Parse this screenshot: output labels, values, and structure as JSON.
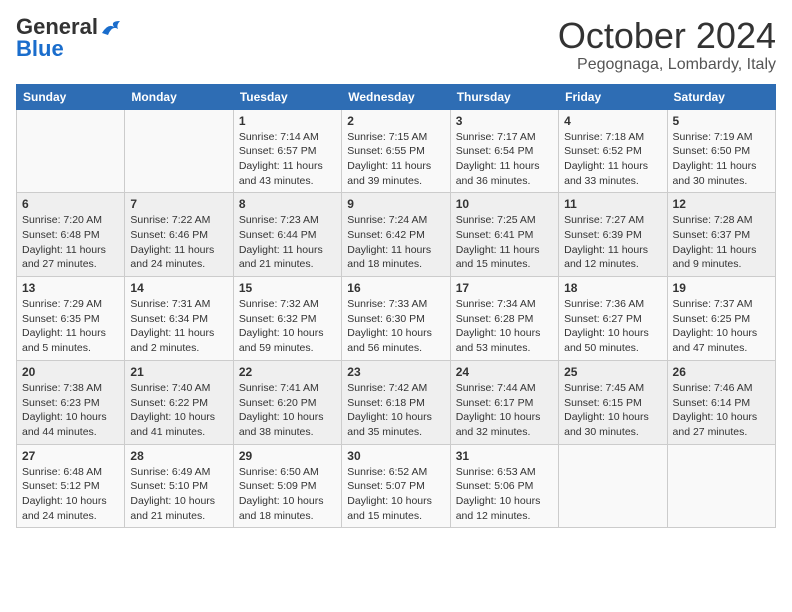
{
  "header": {
    "logo_general": "General",
    "logo_blue": "Blue",
    "title": "October 2024",
    "subtitle": "Pegognaga, Lombardy, Italy"
  },
  "calendar": {
    "days_of_week": [
      "Sunday",
      "Monday",
      "Tuesday",
      "Wednesday",
      "Thursday",
      "Friday",
      "Saturday"
    ],
    "weeks": [
      [
        {
          "day": "",
          "content": ""
        },
        {
          "day": "",
          "content": ""
        },
        {
          "day": "1",
          "content": "Sunrise: 7:14 AM\nSunset: 6:57 PM\nDaylight: 11 hours and 43 minutes."
        },
        {
          "day": "2",
          "content": "Sunrise: 7:15 AM\nSunset: 6:55 PM\nDaylight: 11 hours and 39 minutes."
        },
        {
          "day": "3",
          "content": "Sunrise: 7:17 AM\nSunset: 6:54 PM\nDaylight: 11 hours and 36 minutes."
        },
        {
          "day": "4",
          "content": "Sunrise: 7:18 AM\nSunset: 6:52 PM\nDaylight: 11 hours and 33 minutes."
        },
        {
          "day": "5",
          "content": "Sunrise: 7:19 AM\nSunset: 6:50 PM\nDaylight: 11 hours and 30 minutes."
        }
      ],
      [
        {
          "day": "6",
          "content": "Sunrise: 7:20 AM\nSunset: 6:48 PM\nDaylight: 11 hours and 27 minutes."
        },
        {
          "day": "7",
          "content": "Sunrise: 7:22 AM\nSunset: 6:46 PM\nDaylight: 11 hours and 24 minutes."
        },
        {
          "day": "8",
          "content": "Sunrise: 7:23 AM\nSunset: 6:44 PM\nDaylight: 11 hours and 21 minutes."
        },
        {
          "day": "9",
          "content": "Sunrise: 7:24 AM\nSunset: 6:42 PM\nDaylight: 11 hours and 18 minutes."
        },
        {
          "day": "10",
          "content": "Sunrise: 7:25 AM\nSunset: 6:41 PM\nDaylight: 11 hours and 15 minutes."
        },
        {
          "day": "11",
          "content": "Sunrise: 7:27 AM\nSunset: 6:39 PM\nDaylight: 11 hours and 12 minutes."
        },
        {
          "day": "12",
          "content": "Sunrise: 7:28 AM\nSunset: 6:37 PM\nDaylight: 11 hours and 9 minutes."
        }
      ],
      [
        {
          "day": "13",
          "content": "Sunrise: 7:29 AM\nSunset: 6:35 PM\nDaylight: 11 hours and 5 minutes."
        },
        {
          "day": "14",
          "content": "Sunrise: 7:31 AM\nSunset: 6:34 PM\nDaylight: 11 hours and 2 minutes."
        },
        {
          "day": "15",
          "content": "Sunrise: 7:32 AM\nSunset: 6:32 PM\nDaylight: 10 hours and 59 minutes."
        },
        {
          "day": "16",
          "content": "Sunrise: 7:33 AM\nSunset: 6:30 PM\nDaylight: 10 hours and 56 minutes."
        },
        {
          "day": "17",
          "content": "Sunrise: 7:34 AM\nSunset: 6:28 PM\nDaylight: 10 hours and 53 minutes."
        },
        {
          "day": "18",
          "content": "Sunrise: 7:36 AM\nSunset: 6:27 PM\nDaylight: 10 hours and 50 minutes."
        },
        {
          "day": "19",
          "content": "Sunrise: 7:37 AM\nSunset: 6:25 PM\nDaylight: 10 hours and 47 minutes."
        }
      ],
      [
        {
          "day": "20",
          "content": "Sunrise: 7:38 AM\nSunset: 6:23 PM\nDaylight: 10 hours and 44 minutes."
        },
        {
          "day": "21",
          "content": "Sunrise: 7:40 AM\nSunset: 6:22 PM\nDaylight: 10 hours and 41 minutes."
        },
        {
          "day": "22",
          "content": "Sunrise: 7:41 AM\nSunset: 6:20 PM\nDaylight: 10 hours and 38 minutes."
        },
        {
          "day": "23",
          "content": "Sunrise: 7:42 AM\nSunset: 6:18 PM\nDaylight: 10 hours and 35 minutes."
        },
        {
          "day": "24",
          "content": "Sunrise: 7:44 AM\nSunset: 6:17 PM\nDaylight: 10 hours and 32 minutes."
        },
        {
          "day": "25",
          "content": "Sunrise: 7:45 AM\nSunset: 6:15 PM\nDaylight: 10 hours and 30 minutes."
        },
        {
          "day": "26",
          "content": "Sunrise: 7:46 AM\nSunset: 6:14 PM\nDaylight: 10 hours and 27 minutes."
        }
      ],
      [
        {
          "day": "27",
          "content": "Sunrise: 6:48 AM\nSunset: 5:12 PM\nDaylight: 10 hours and 24 minutes."
        },
        {
          "day": "28",
          "content": "Sunrise: 6:49 AM\nSunset: 5:10 PM\nDaylight: 10 hours and 21 minutes."
        },
        {
          "day": "29",
          "content": "Sunrise: 6:50 AM\nSunset: 5:09 PM\nDaylight: 10 hours and 18 minutes."
        },
        {
          "day": "30",
          "content": "Sunrise: 6:52 AM\nSunset: 5:07 PM\nDaylight: 10 hours and 15 minutes."
        },
        {
          "day": "31",
          "content": "Sunrise: 6:53 AM\nSunset: 5:06 PM\nDaylight: 10 hours and 12 minutes."
        },
        {
          "day": "",
          "content": ""
        },
        {
          "day": "",
          "content": ""
        }
      ]
    ]
  }
}
